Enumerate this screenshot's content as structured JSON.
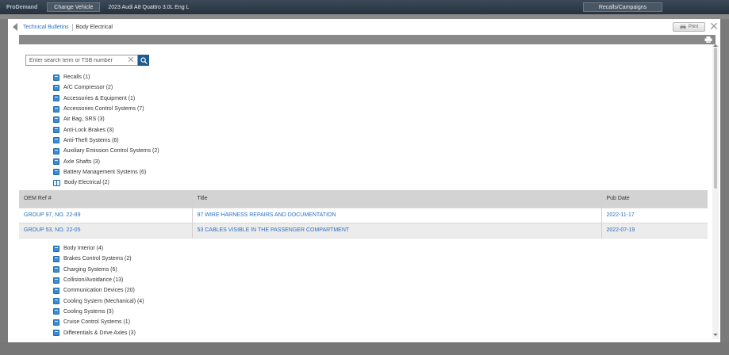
{
  "app": {
    "brand": "ProDemand",
    "change_vehicle": "Change Vehicle",
    "vehicle": "2023 Audi A8 Quattro 3.0L Eng L",
    "recalls": "Recalls/Campaigns"
  },
  "breadcrumb": {
    "link": "Technical Bulletins",
    "current": "Body Electrical"
  },
  "toolbar": {
    "print_label": "Print"
  },
  "search": {
    "placeholder": "Enter search term or TSB number"
  },
  "categories_top": [
    {
      "label": "Recalls (1)",
      "open": false
    },
    {
      "label": "A/C Compressor (2)",
      "open": false
    },
    {
      "label": "Accessories & Equipment (1)",
      "open": false
    },
    {
      "label": "Accessories Control Systems (7)",
      "open": false
    },
    {
      "label": "Air Bag, SRS (3)",
      "open": false
    },
    {
      "label": "Anti-Lock Brakes (3)",
      "open": false
    },
    {
      "label": "Anti-Theft Systems (6)",
      "open": false
    },
    {
      "label": "Auxiliary Emission Control Systems (2)",
      "open": false
    },
    {
      "label": "Axle Shafts (3)",
      "open": false
    },
    {
      "label": "Battery Management Systems (6)",
      "open": false
    },
    {
      "label": "Body Electrical (2)",
      "open": true
    }
  ],
  "table": {
    "headers": [
      "OEM Ref #",
      "Title",
      "Pub Date"
    ],
    "rows": [
      [
        "GROUP 97, NO. 22-89",
        "97 WIRE HARNESS REPAIRS AND DOCUMENTATION",
        "2022-11-17"
      ],
      [
        "GROUP 53, NO. 22-05",
        "53 CABLES VISIBLE IN THE PASSENGER COMPARTMENT",
        "2022-07-19"
      ]
    ]
  },
  "categories_bottom": [
    {
      "label": "Body Interior (4)"
    },
    {
      "label": "Brakes Control Systems (2)"
    },
    {
      "label": "Charging Systems (6)"
    },
    {
      "label": "Collision/Avoidance (13)"
    },
    {
      "label": "Communication Devices (20)"
    },
    {
      "label": "Cooling System (Mechanical) (4)"
    },
    {
      "label": "Cooling Systems (3)"
    },
    {
      "label": "Cruise Control Systems (1)"
    },
    {
      "label": "Differentials & Drive Axles (3)"
    }
  ],
  "colors": {
    "link": "#2c6fbf",
    "header_bar": "#26313d",
    "search_button": "#1d5b8f",
    "category_icon": "#3a8dd3"
  }
}
